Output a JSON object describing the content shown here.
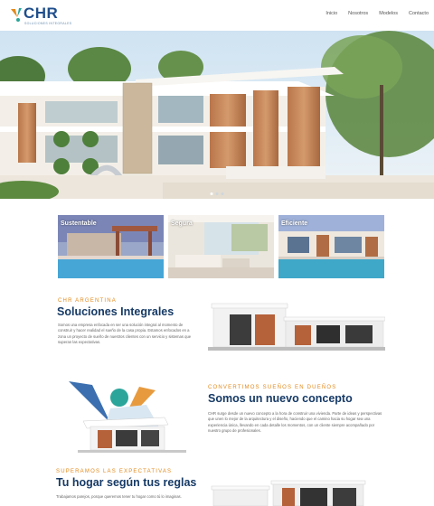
{
  "brand": {
    "name": "CHR",
    "tagline": "SOLUCIONES INTEGRALES",
    "colors": {
      "navy": "#163a66",
      "orange": "#e38a1c",
      "teal": "#2ba59a",
      "blue": "#1e4e8c"
    }
  },
  "nav": {
    "items": [
      {
        "label": "Inicio",
        "icon": ""
      },
      {
        "label": "Nosotros",
        "icon": ""
      },
      {
        "label": "Modelos",
        "icon": ""
      },
      {
        "label": "Contacto",
        "icon": ""
      }
    ]
  },
  "hero": {
    "image": "modern-house-render",
    "slides_total": 3,
    "active_slide": 1
  },
  "cards": [
    {
      "label": "Sustentable",
      "image": "pergola-pool-render"
    },
    {
      "label": "Segura",
      "image": "interior-living-render"
    },
    {
      "label": "Eficiente",
      "image": "house-pool-render"
    }
  ],
  "section1": {
    "kicker": "CHR ARGENTINA",
    "heading": "Soluciones Integrales",
    "body": "Somos una empresa enfocada en ser una solución integral al momento de construir y hacer realidad el sueño de la casa propia. Estamos enfocados en a zona un proyecto de sueño de nuestros clientes con un servicio y sistemas que superan las expectativas.",
    "image": "house-render-side"
  },
  "section2": {
    "kicker": "CONVERTIMOS SUEÑOS EN DUEÑOS",
    "heading": "Somos un nuevo concepto",
    "body": "CHR surge desde un nuevo concepto a la hora de construir una vivienda. Parte de ideas y perspectivas que unen lo mejor de la arquitectura y el diseño, haciendo que el camino hacia su hogar sea una experiencia única, llevando en cada detalle los momentos, con un cliente siempre acompañado por nuestro grupo de profesionales.",
    "image": "house-logo-illustration"
  },
  "section3": {
    "kicker": "SUPERAMOS LAS EXPECTATIVAS",
    "heading": "Tu hogar según tus reglas",
    "body": "Trabajamos parejos, porque queremos tener tu hogar como tú lo imaginas.",
    "image": "house-render-front"
  }
}
